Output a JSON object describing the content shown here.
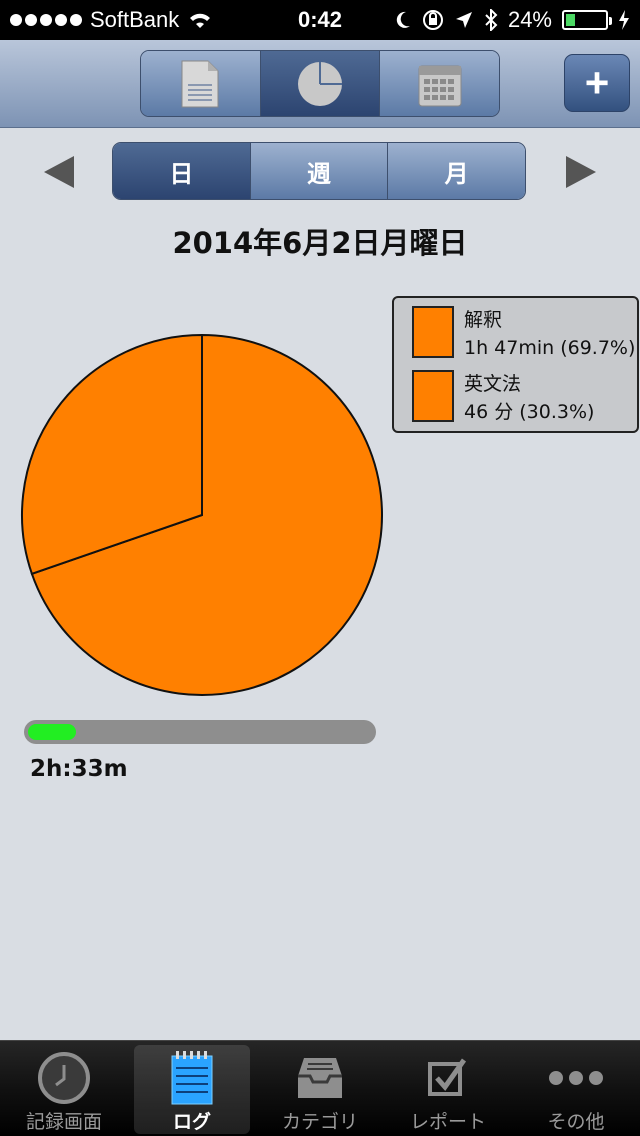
{
  "status_bar": {
    "carrier": "SoftBank",
    "time": "0:42",
    "battery": "24%",
    "battery_level": 0.24
  },
  "nav_bar": {
    "views": [
      {
        "icon": "document-icon",
        "active": false
      },
      {
        "icon": "pie-chart-icon",
        "active": true
      },
      {
        "icon": "calendar-icon",
        "active": false
      }
    ],
    "add_label": "+"
  },
  "period": {
    "tabs": [
      {
        "label": "日",
        "active": true
      },
      {
        "label": "週",
        "active": false
      },
      {
        "label": "月",
        "active": false
      }
    ]
  },
  "date_title": "2014年6月2日月曜日",
  "chart_data": {
    "type": "pie",
    "slices": [
      {
        "label": "解釈",
        "value_text": "1h 47min (69.7%)",
        "percent": 69.7,
        "minutes": 107,
        "color": "#ff8000"
      },
      {
        "label": "英文法",
        "value_text": "46 分 (30.3%)",
        "percent": 30.3,
        "minutes": 46,
        "color": "#ff8000"
      }
    ]
  },
  "progress": {
    "fraction": 0.14,
    "color": "#22ee22"
  },
  "total_time": "2h:33m",
  "tab_bar": {
    "items": [
      {
        "label": "記録画面",
        "icon": "clock-icon",
        "active": false
      },
      {
        "label": "ログ",
        "icon": "notepad-icon",
        "active": true
      },
      {
        "label": "カテゴリ",
        "icon": "inbox-tray-icon",
        "active": false
      },
      {
        "label": "レポート",
        "icon": "checkbox-icon",
        "active": false
      },
      {
        "label": "その他",
        "icon": "more-dots-icon",
        "active": false
      }
    ]
  }
}
